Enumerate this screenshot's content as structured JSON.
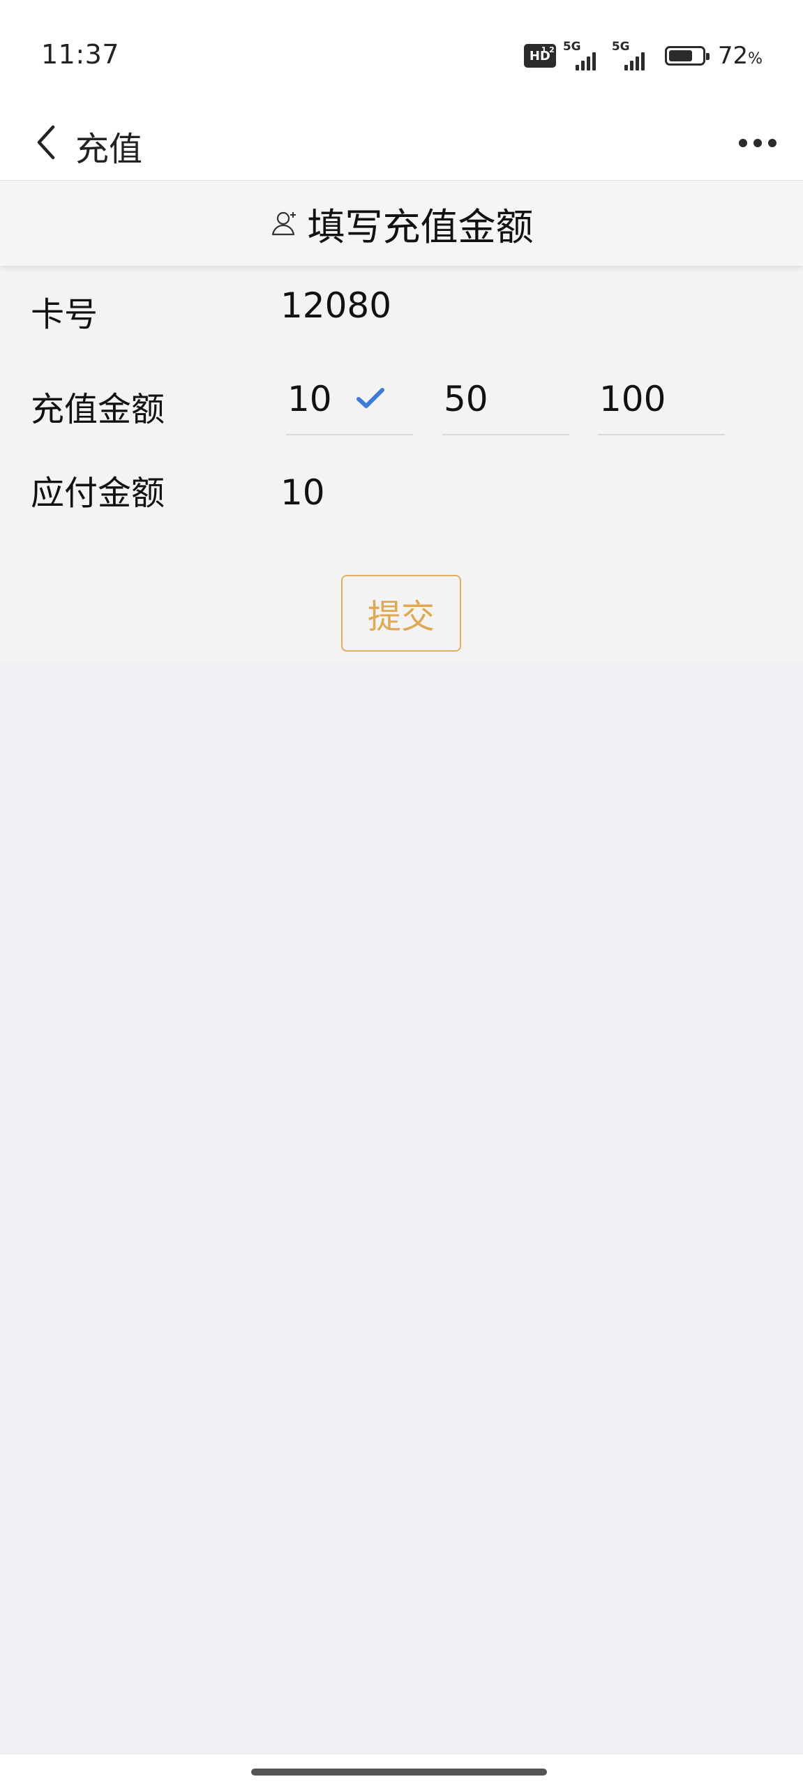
{
  "status_bar": {
    "time": "11:37",
    "hd_label": "HD",
    "hd_sub": "1 2",
    "network_1": "5G",
    "network_2": "5G",
    "battery_level": 0.72,
    "battery_percent": "72",
    "battery_unit": "%"
  },
  "nav": {
    "title": "充值"
  },
  "section": {
    "title": "填写充值金额"
  },
  "form": {
    "card_label": "卡号",
    "card_value": "12080",
    "amount_label": "充值金额",
    "amount_options": [
      {
        "label": "10",
        "selected": true
      },
      {
        "label": "50",
        "selected": false
      },
      {
        "label": "100",
        "selected": false
      }
    ],
    "payable_label": "应付金额",
    "payable_value": "10",
    "submit_label": "提交"
  },
  "colors": {
    "accent_check": "#3a7bdc",
    "submit_border": "#e0b060",
    "submit_text": "#e0a850",
    "page_bg": "#efeff4"
  }
}
